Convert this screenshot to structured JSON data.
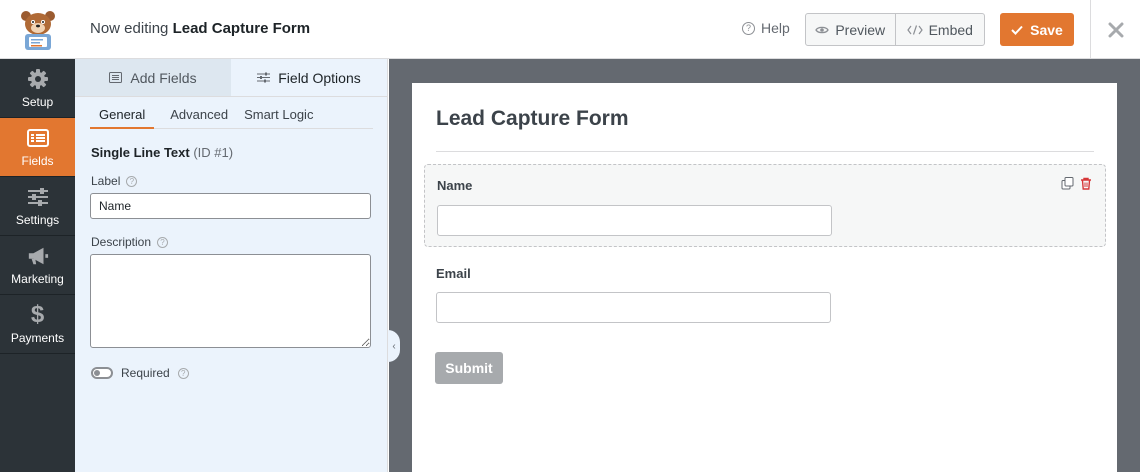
{
  "header": {
    "editing_prefix": "Now editing",
    "form_name": "Lead Capture Form",
    "help_label": "Help",
    "preview_label": "Preview",
    "embed_label": "Embed",
    "save_label": "Save"
  },
  "nav": [
    {
      "label": "Setup",
      "icon": "gear-icon"
    },
    {
      "label": "Fields",
      "icon": "fields-icon",
      "active": true
    },
    {
      "label": "Settings",
      "icon": "sliders-icon"
    },
    {
      "label": "Marketing",
      "icon": "megaphone-icon"
    },
    {
      "label": "Payments",
      "icon": "dollar-icon"
    }
  ],
  "panel": {
    "tabs": [
      {
        "label": "Add Fields",
        "icon": "list-icon"
      },
      {
        "label": "Field Options",
        "icon": "sliders-icon",
        "active": true
      }
    ],
    "subtabs": [
      "General",
      "Advanced",
      "Smart Logic"
    ],
    "field_type": "Single Line Text",
    "field_id": "(ID #1)",
    "label_label": "Label",
    "label_value": "Name",
    "description_label": "Description",
    "description_value": "",
    "required_label": "Required",
    "required_on": false
  },
  "form": {
    "title": "Lead Capture Form",
    "fields": [
      {
        "label": "Name"
      },
      {
        "label": "Email"
      }
    ],
    "submit_label": "Submit"
  },
  "colors": {
    "accent": "#e27730",
    "nav_bg": "#2c3338",
    "panel_bg": "#ebf3fc",
    "preview_bg": "#646970"
  }
}
